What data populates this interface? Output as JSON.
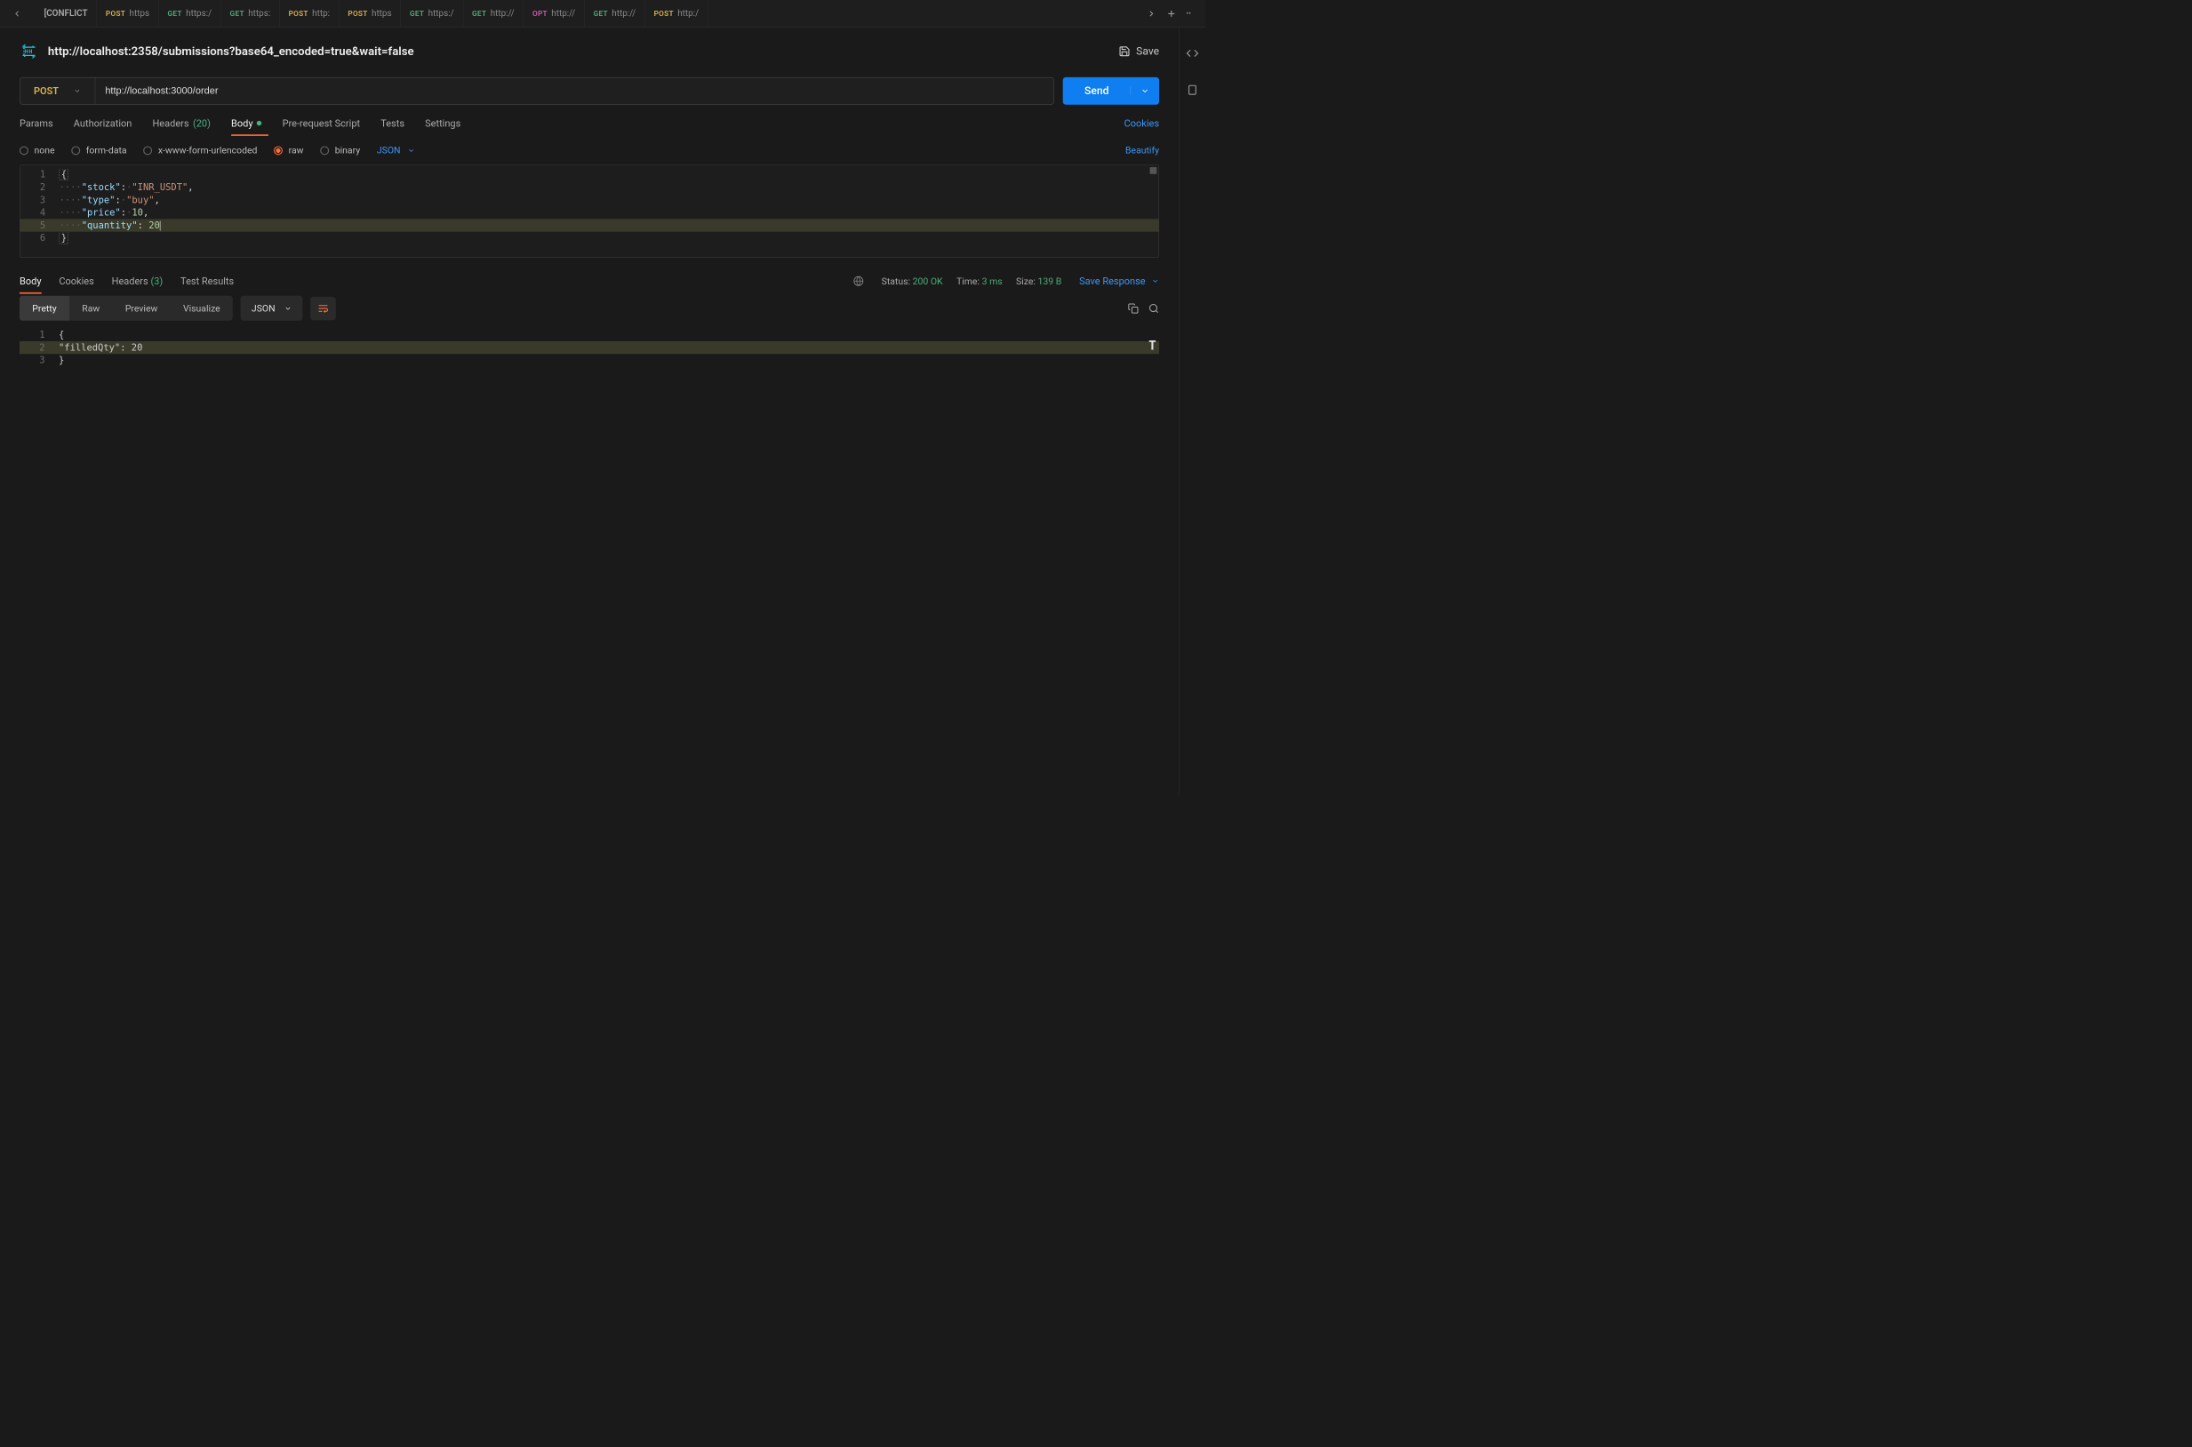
{
  "topTabs": {
    "conflict": "[CONFLICT",
    "items": [
      {
        "method": "POST",
        "mclass": "post",
        "label": "https"
      },
      {
        "method": "GET",
        "mclass": "get",
        "label": "https:/"
      },
      {
        "method": "GET",
        "mclass": "get",
        "label": "https:"
      },
      {
        "method": "POST",
        "mclass": "post",
        "label": "http:"
      },
      {
        "method": "POST",
        "mclass": "post",
        "label": "https"
      },
      {
        "method": "GET",
        "mclass": "get",
        "label": "https:/"
      },
      {
        "method": "GET",
        "mclass": "get",
        "label": "http://"
      },
      {
        "method": "OPT",
        "mclass": "opt",
        "label": "http://"
      },
      {
        "method": "GET",
        "mclass": "get",
        "label": "http://"
      },
      {
        "method": "POST",
        "mclass": "post",
        "label": "http:/"
      }
    ]
  },
  "titleRow": {
    "title": "http://localhost:2358/submissions?base64_encoded=true&wait=false",
    "save": "Save"
  },
  "request": {
    "method": "POST",
    "url": "http://localhost:3000/order",
    "send": "Send"
  },
  "reqTabs": {
    "params": "Params",
    "auth": "Authorization",
    "headers": "Headers",
    "headersCount": "(20)",
    "body": "Body",
    "prereq": "Pre-request Script",
    "tests": "Tests",
    "settings": "Settings",
    "cookies": "Cookies"
  },
  "bodyTypes": {
    "none": "none",
    "formdata": "form-data",
    "xwww": "x-www-form-urlencoded",
    "raw": "raw",
    "binary": "binary",
    "lang": "JSON",
    "beautify": "Beautify"
  },
  "reqBody": {
    "stock_key": "\"stock\"",
    "stock_val": "\"INR_USDT\"",
    "type_key": "\"type\"",
    "type_val": "\"buy\"",
    "price_key": "\"price\"",
    "price_val": "10",
    "qty_key": "\"quantity\"",
    "qty_val": "20",
    "line1": "1",
    "line2": "2",
    "line3": "3",
    "line4": "4",
    "line5": "5",
    "line6": "6",
    "indent": "····"
  },
  "respTabs": {
    "body": "Body",
    "cookies": "Cookies",
    "headers": "Headers",
    "headersCount": "(3)",
    "tests": "Test Results",
    "statusLbl": "Status:",
    "statusVal": "200 OK",
    "timeLbl": "Time:",
    "timeVal": "3 ms",
    "sizeLbl": "Size:",
    "sizeVal": "139 B",
    "saveResp": "Save Response"
  },
  "respView": {
    "pretty": "Pretty",
    "raw": "Raw",
    "preview": "Preview",
    "visualize": "Visualize",
    "lang": "JSON"
  },
  "respBody": {
    "line1": "1",
    "line2": "2",
    "line3": "3",
    "key": "\"filledQty\"",
    "val": "20",
    "big": "T"
  }
}
